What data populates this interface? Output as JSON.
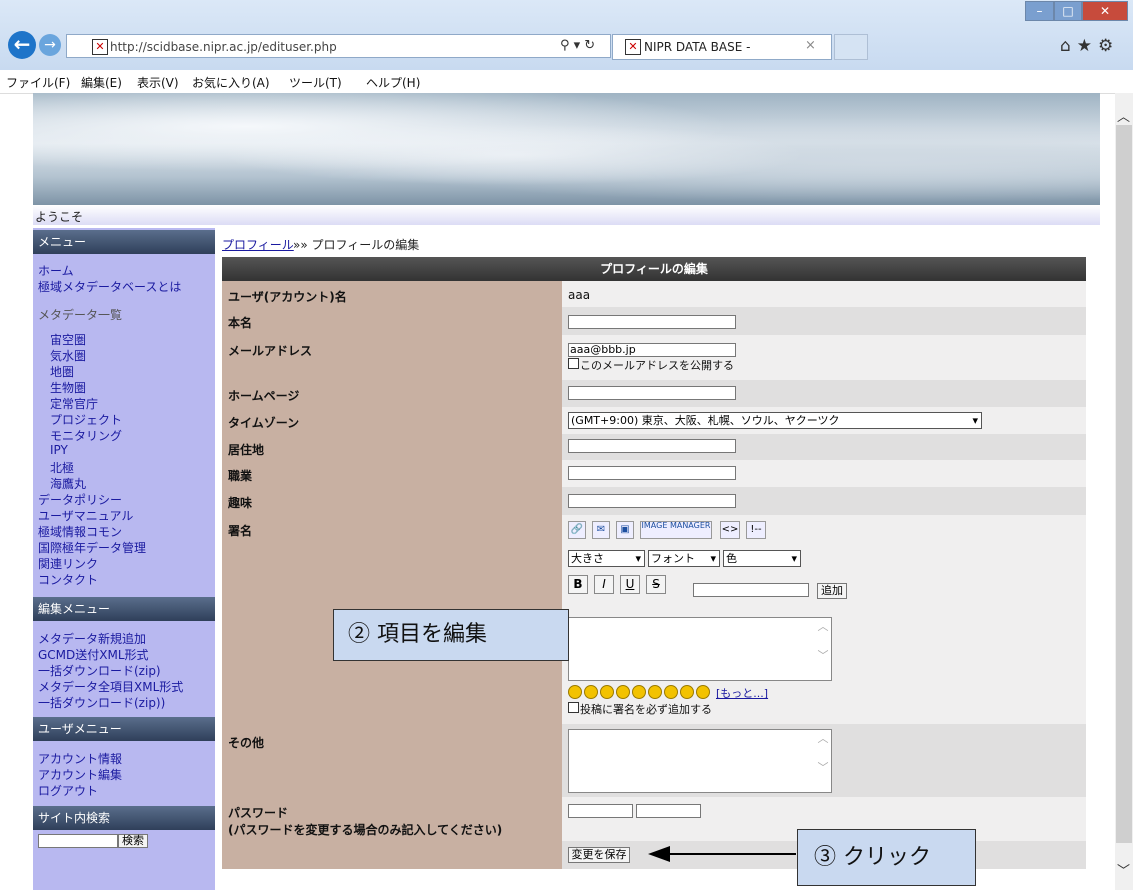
{
  "browser": {
    "url": "http://scidbase.nipr.ac.jp/edituser.php",
    "tab_title": "NIPR DATA BASE -",
    "menu": [
      "ファイル(F)",
      "編集(E)",
      "表示(V)",
      "お気に入り(A)",
      "ツール(T)",
      "ヘルプ(H)"
    ]
  },
  "page": {
    "welcome": "ようこそ",
    "breadcrumb_link": "プロフィール",
    "breadcrumb_rest": "»» プロフィールの編集"
  },
  "sidebar": {
    "menu_title": "メニュー",
    "top_items": [
      "ホーム",
      "極域メタデータベースとは"
    ],
    "metadata_title": "メタデータ一覧",
    "metadata_items": [
      "宙空圏",
      "気水圏",
      "地圏",
      "生物圏",
      "定常官庁",
      "プロジェクト",
      "モニタリング",
      "IPY",
      "北極",
      "海鷹丸"
    ],
    "other_items": [
      "データポリシー",
      "ユーザマニュアル",
      "極域情報コモン",
      "国際極年データ管理",
      "関連リンク",
      "コンタクト"
    ],
    "edit_menu_title": "編集メニュー",
    "edit_items": [
      "メタデータ新規追加",
      "GCMD送付XML形式",
      "一括ダウンロード(zip)",
      "メタデータ全項目XML形式",
      "一括ダウンロード(zip))"
    ],
    "user_menu_title": "ユーザメニュー",
    "user_items": [
      "アカウント情報",
      "アカウント編集",
      "ログアウト"
    ],
    "search_title": "サイト内検索",
    "search_button": "検索"
  },
  "form": {
    "title": "プロフィールの編集",
    "labels": {
      "account": "ユーザ(アカウント)名",
      "realname": "本名",
      "email": "メールアドレス",
      "homepage": "ホームページ",
      "timezone": "タイムゾーン",
      "location": "居住地",
      "occupation": "職業",
      "hobby": "趣味",
      "signature": "署名",
      "other": "その他",
      "password": "パスワード",
      "password_note": "(パスワードを変更する場合のみ記入してください)"
    },
    "account_value": "aaa",
    "email_value": "aaa@bbb.jp",
    "email_public_label": "このメールアドレスを公開する",
    "timezone_value": "(GMT+9:00) 東京、大阪、札幌、ソウル、ヤクーツク",
    "toolbar_image_manager": "IMAGE MANAGER",
    "size_select": "大きさ",
    "font_select": "フォント",
    "color_select": "色",
    "add_button": "追加",
    "more_link": "[もっと...]",
    "signature_always_label": "投稿に署名を必ず追加する",
    "save_button": "変更を保存"
  },
  "annotations": {
    "edit_note": "② 項目を編集",
    "click_note": "③ クリック"
  }
}
